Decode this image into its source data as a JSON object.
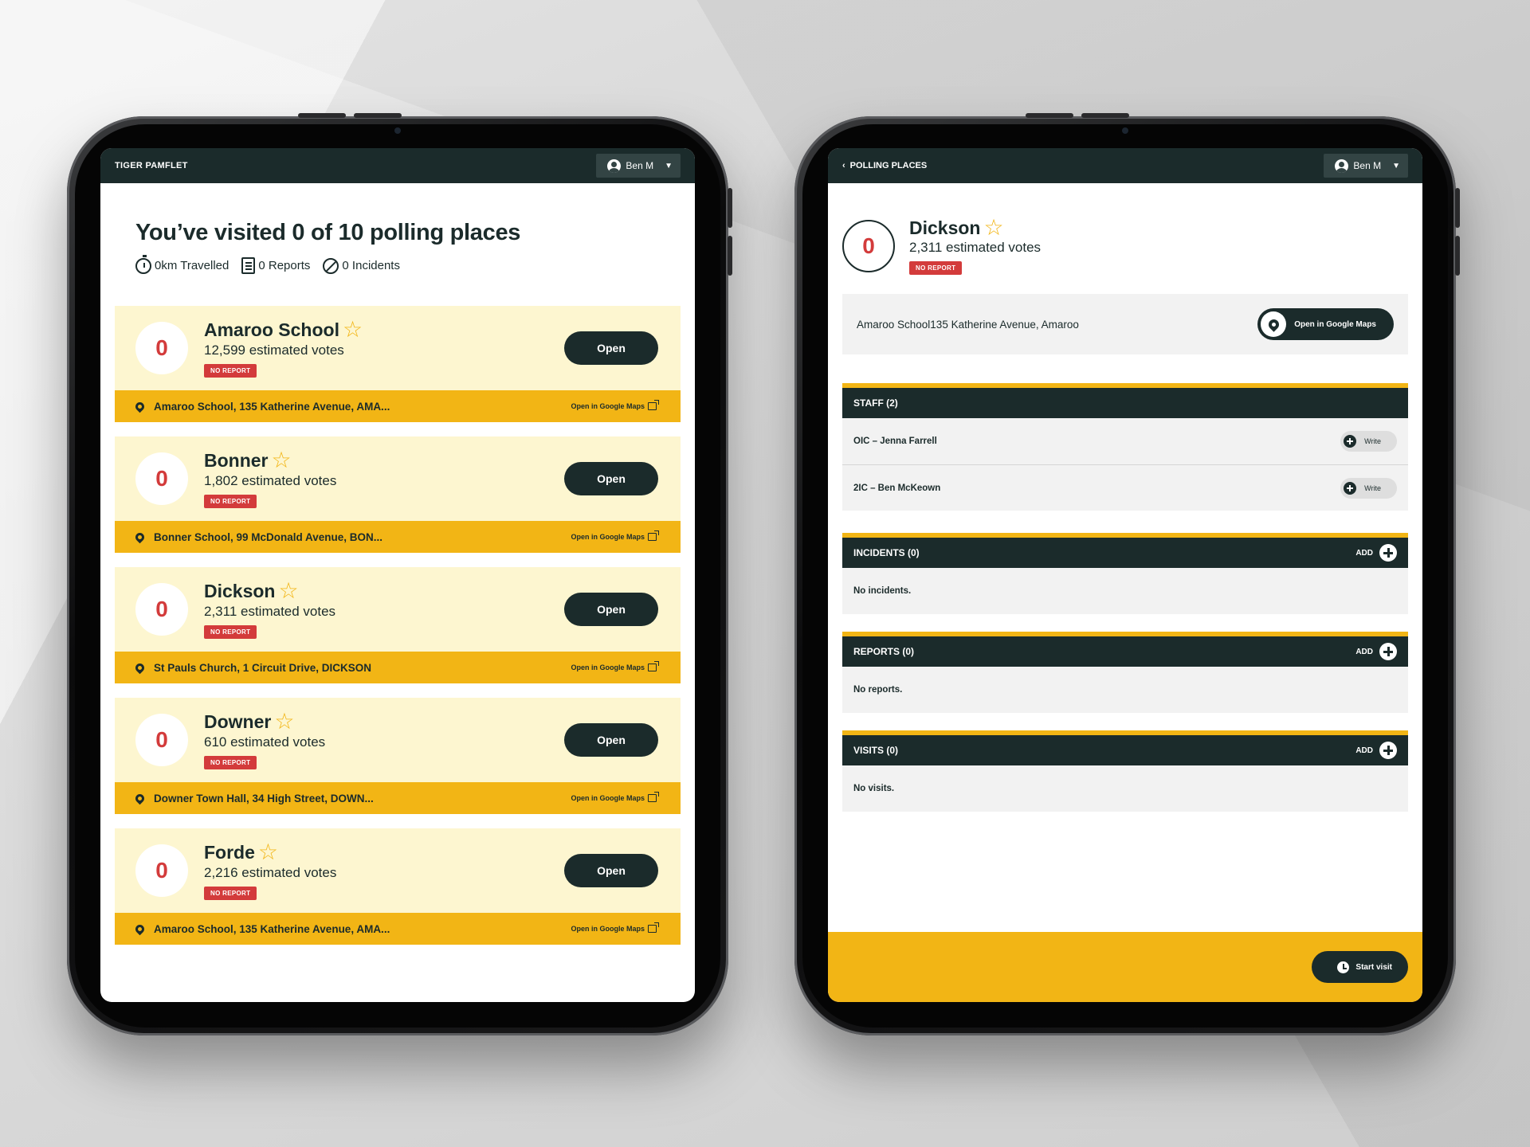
{
  "app": {
    "title": "TIGER PAMFLET",
    "user_name": "Ben M"
  },
  "summary": {
    "heading": "You’ve visited 0 of 10 polling places",
    "stats": [
      {
        "icon": "stopwatch-icon",
        "label": "0km Travelled"
      },
      {
        "icon": "report-icon",
        "label": "0 Reports"
      },
      {
        "icon": "incident-icon",
        "label": "0 Incidents"
      }
    ]
  },
  "polling_places": [
    {
      "count": "0",
      "name": "Amaroo School",
      "votes": "12,599 estimated votes",
      "status": "NO REPORT",
      "address": "Amaroo School, 135 Katherine Avenue, AMA...",
      "open_label": "Open",
      "maps_label": "Open in Google Maps"
    },
    {
      "count": "0",
      "name": "Bonner",
      "votes": "1,802 estimated votes",
      "status": "NO REPORT",
      "address": "Bonner School, 99 McDonald Avenue, BON...",
      "open_label": "Open",
      "maps_label": "Open in Google Maps"
    },
    {
      "count": "0",
      "name": "Dickson",
      "votes": "2,311 estimated votes",
      "status": "NO REPORT",
      "address": "St Pauls Church, 1 Circuit Drive, DICKSON",
      "open_label": "Open",
      "maps_label": "Open in Google Maps"
    },
    {
      "count": "0",
      "name": "Downer",
      "votes": "610 estimated votes",
      "status": "NO REPORT",
      "address": "Downer Town Hall, 34 High Street, DOWN...",
      "open_label": "Open",
      "maps_label": "Open in Google Maps"
    },
    {
      "count": "0",
      "name": "Forde",
      "votes": "2,216 estimated votes",
      "status": "NO REPORT",
      "address": "Amaroo School, 135 Katherine Avenue, AMA...",
      "open_label": "Open",
      "maps_label": "Open in Google Maps"
    }
  ],
  "detail": {
    "back_label": "POLLING PLACES",
    "user_name": "Ben M",
    "count": "0",
    "name": "Dickson",
    "votes": "2,311 estimated votes",
    "status": "NO REPORT",
    "address": "Amaroo School135 Katherine Avenue, Amaroo",
    "maps_label": "Open in Google Maps",
    "staff": {
      "title": "STAFF (2)",
      "members": [
        {
          "label": "OIC – Jenna Farrell",
          "action": "Write"
        },
        {
          "label": "2IC – Ben McKeown",
          "action": "Write"
        }
      ]
    },
    "incidents": {
      "title": "INCIDENTS (0)",
      "add_label": "ADD",
      "empty": "No incidents."
    },
    "reports": {
      "title": "REPORTS (0)",
      "add_label": "ADD",
      "empty": "No reports."
    },
    "visits": {
      "title": "VISITS (0)",
      "add_label": "ADD",
      "empty": "No visits."
    },
    "start_label": "Start visit"
  },
  "colors": {
    "dark": "#1b2b2b",
    "accent": "#f2b515",
    "card_bg": "#fdf6d0",
    "alert": "#d33b3b"
  }
}
